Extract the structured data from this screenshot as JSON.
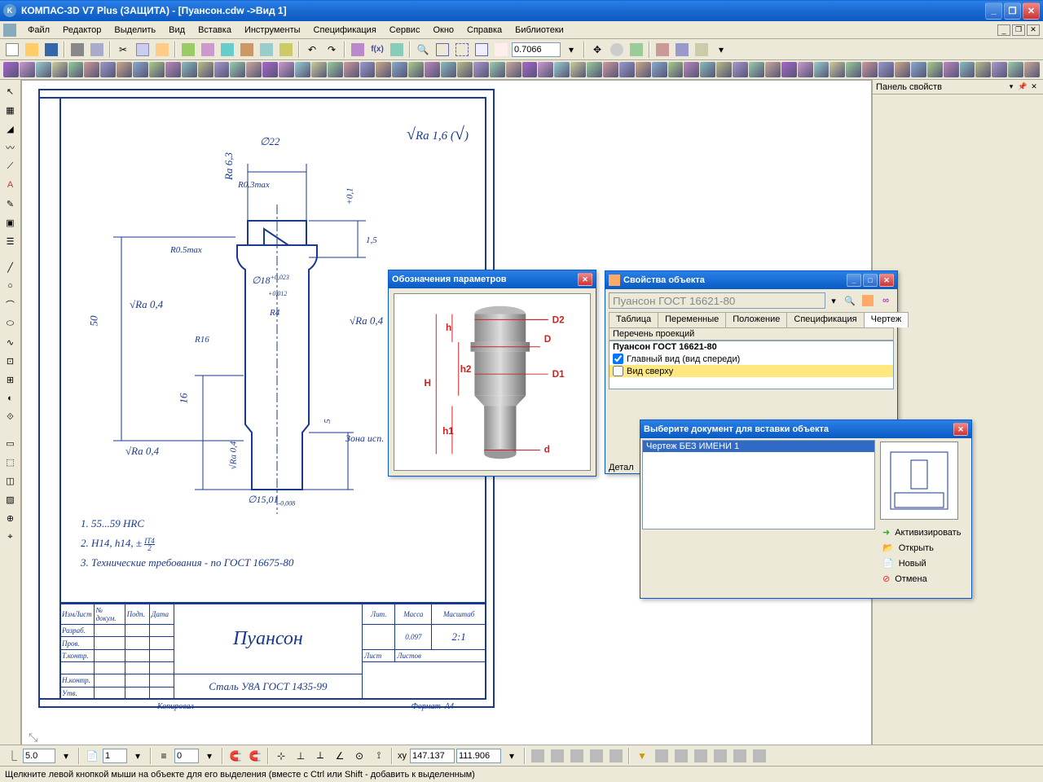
{
  "app": {
    "title": "КОМПАС-3D V7 Plus (ЗАЩИТА) - [Пуансон.cdw ->Вид 1]"
  },
  "menu": {
    "items": [
      "Файл",
      "Редактор",
      "Выделить",
      "Вид",
      "Вставка",
      "Инструменты",
      "Спецификация",
      "Сервис",
      "Окно",
      "Справка",
      "Библиотеки"
    ]
  },
  "zoom": {
    "value": "0.7066"
  },
  "rpanel": {
    "title": "Панель свойств"
  },
  "drawing": {
    "ra_global": "Ra 1,6",
    "dim_d22": "∅22",
    "ra63": "Ra 6,3",
    "r03max": "R0.3max",
    "r05max": "R0.5max",
    "ra04_1": "Ra 0,4",
    "ra04_2": "Ra 0,4",
    "ra04_3": "Ra 0,4",
    "ra04_4": "Ra 0,4",
    "r16": "R16",
    "r4": "R4",
    "d18": "∅18",
    "d18tol_up": "+0,023",
    "d18tol_dn": "+0,012",
    "dim50": "50",
    "dim16": "16",
    "dim5": "5",
    "dim15": "1,5",
    "angled": "+0,1",
    "zone": "Зона исп.",
    "d15": "∅15,01",
    "d15tol": "-0,008",
    "note1": "1. 55...59 HRC",
    "note2": "2. H14, h14, ±",
    "note2_frac": "IT4",
    "note2_den": "2",
    "note3": "3. Технические требования - по ГОСТ 16675-80",
    "tb_rows": {
      "r1": "ИзмЛист",
      "r2": "Разраб.",
      "r3": "Пров.",
      "r4": "Т.контр.",
      "r5": "Н.контр.",
      "r6": "Утв."
    },
    "tb_cols": {
      "c2": "№ докум.",
      "c3": "Подп.",
      "c4": "Дата"
    },
    "part_name": "Пуансон",
    "material": "Сталь У8А ГОСТ 1435-99",
    "tb_lit": "Лит.",
    "tb_mass": "Масса",
    "tb_scale": "Масштаб",
    "mass_val": "0.097",
    "scale_val": "2:1",
    "tb_list": "Лист",
    "tb_lists": "Листов",
    "kopir": "Копировал",
    "format": "Формат",
    "format_val": "А4"
  },
  "dlg_params": {
    "title": "Обозначения параметров",
    "labels": {
      "D2": "D2",
      "D": "D",
      "D1": "D1",
      "d": "d",
      "h": "h",
      "h1": "h1",
      "h2": "h2",
      "H": "H"
    }
  },
  "dlg_props": {
    "title": "Свойства объекта",
    "combo": "Пуансон ГОСТ 16621-80",
    "tabs": [
      "Таблица",
      "Переменные",
      "Положение",
      "Спецификация",
      "Чертеж"
    ],
    "section": "Перечень проекций",
    "item_bold": "Пуансон ГОСТ 16621-80",
    "proj1": "Главный вид (вид спереди)",
    "proj2": "Вид сверху",
    "detail": "Детал"
  },
  "dlg_insert": {
    "title": "Выберите документ для вставки объекта",
    "item1": "Чертеж БЕЗ ИМЕНИ 1",
    "btn_activate": "Активизировать",
    "btn_open": "Открыть",
    "btn_new": "Новый",
    "btn_cancel": "Отмена"
  },
  "bottombar": {
    "v1": "5.0",
    "v2": "1",
    "v3": "0",
    "coord_x": "147.137",
    "coord_y": "111.906"
  },
  "statusbar": {
    "text": "Щелкните левой кнопкой мыши на объекте для его выделения (вместе с Ctrl или Shift - добавить к выделенным)"
  }
}
